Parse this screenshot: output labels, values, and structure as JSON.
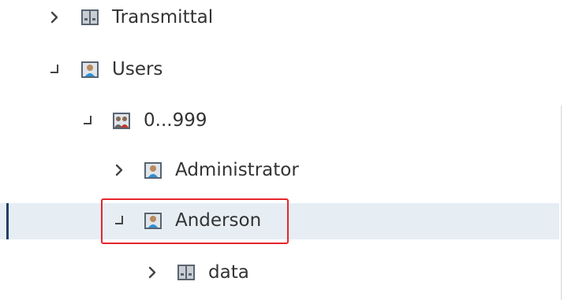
{
  "tree": {
    "nodes": [
      {
        "label": "Transmittal",
        "icon": "binder-icon",
        "state": "collapsed"
      },
      {
        "label": "Users",
        "icon": "user-folder-icon",
        "state": "expanded"
      },
      {
        "label": "0...999",
        "icon": "user-group-icon",
        "state": "expanded"
      },
      {
        "label": "Administrator",
        "icon": "user-folder-icon",
        "state": "collapsed"
      },
      {
        "label": "Anderson",
        "icon": "user-folder-icon",
        "state": "expanded",
        "selected": true
      },
      {
        "label": "data",
        "icon": "binder-icon",
        "state": "collapsed"
      }
    ]
  },
  "colors": {
    "selection_bg": "#e6eef4",
    "selection_bar": "#1d3f66",
    "highlight_border": "#e8242c",
    "text": "#333333"
  }
}
